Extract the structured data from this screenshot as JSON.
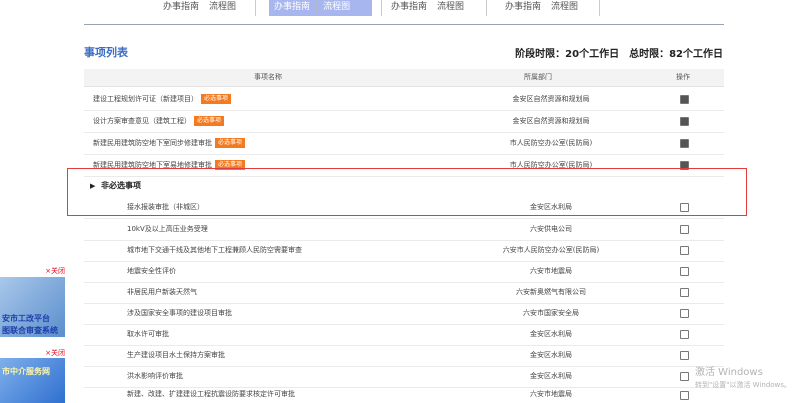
{
  "tabs": [
    {
      "guide": "办事指南",
      "flow": "流程图",
      "active": false
    },
    {
      "guide": "办事指南",
      "flow": "流程图",
      "active": true
    },
    {
      "guide": "办事指南",
      "flow": "流程图",
      "active": false
    },
    {
      "guide": "办事指南",
      "flow": "流程图",
      "active": false
    }
  ],
  "section": {
    "title": "事项列表",
    "stage_limit": "阶段时限：20个工作日",
    "total_limit": "总时限：82个工作日"
  },
  "table": {
    "headers": {
      "name": "事项名称",
      "dept": "所属部门",
      "op": "操作"
    },
    "required_badge": "必选事项",
    "required_rows": [
      {
        "name": "建设工程规划许可证（新建项目）",
        "dept": "金安区自然资源和规划局",
        "checked": true
      },
      {
        "name": "设计方案审查意见（建筑工程）",
        "dept": "金安区自然资源和规划局",
        "checked": true
      },
      {
        "name": "新建民用建筑防空地下室同步修建审批",
        "dept": "市人民防空办公室(民防局)",
        "checked": true
      },
      {
        "name": "新建民用建筑防空地下室易地修建审批",
        "dept": "市人民防空办公室(民防局)",
        "checked": true
      }
    ],
    "optional_group_label": "非必选事项",
    "optional_rows": [
      {
        "name": "接水报装审批（非城区）",
        "dept": "金安区水利局",
        "checked": false
      },
      {
        "name": "10kV及以上高压业务受理",
        "dept": "六安供电公司",
        "checked": false
      },
      {
        "name": "城市地下交通干线及其他地下工程兼顾人民防空需要审查",
        "dept": "六安市人民防空办公室(民防局)",
        "checked": false
      },
      {
        "name": "地震安全性评价",
        "dept": "六安市地震局",
        "checked": false
      },
      {
        "name": "非居民用户新装天然气",
        "dept": "六安新奥燃气有限公司",
        "checked": false
      },
      {
        "name": "涉及国家安全事项的建设项目审批",
        "dept": "六安市国家安全局",
        "checked": false
      },
      {
        "name": "取水许可审批",
        "dept": "金安区水利局",
        "checked": false
      },
      {
        "name": "生产建设项目水土保持方案审批",
        "dept": "金安区水利局",
        "checked": false
      },
      {
        "name": "洪水影响评价审批",
        "dept": "金安区水利局",
        "checked": false
      },
      {
        "name": "新建、改建、扩建建设工程抗震设防要求核定许可审批",
        "dept": "六安市地震局",
        "checked": false
      }
    ]
  },
  "ads": {
    "close_label": "×关闭",
    "ad1_line1": "安市工改平台",
    "ad1_line2": "图联合审查系统",
    "ad2_line1": "市中介服务网"
  },
  "watermark": {
    "line1": "激活 Windows",
    "line2": "转到\"设置\"以激活 Windows。"
  }
}
